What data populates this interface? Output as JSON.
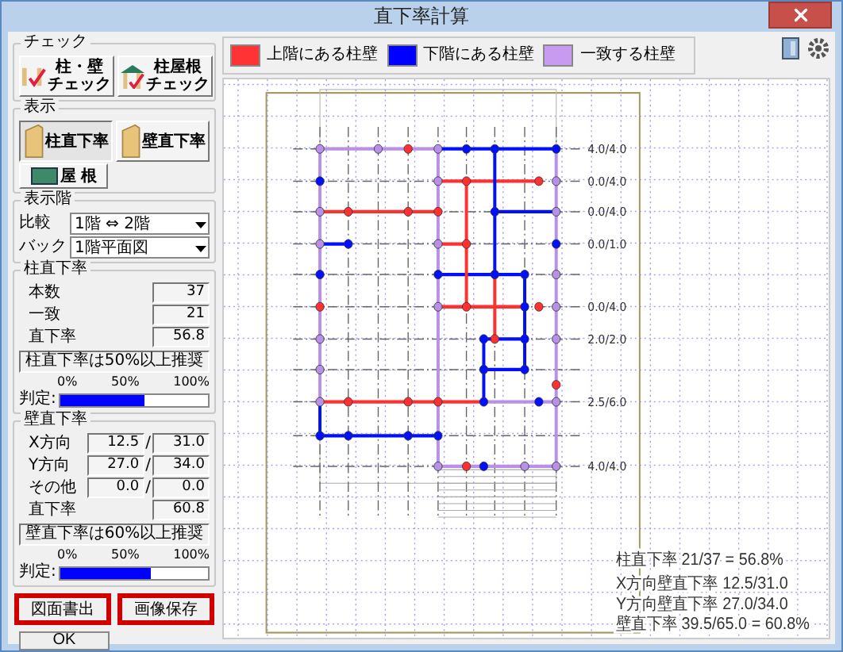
{
  "window": {
    "title": "直下率計算"
  },
  "check_group": {
    "title": "チェック",
    "buttons": [
      {
        "lines": [
          "柱・壁",
          "チェック"
        ]
      },
      {
        "lines": [
          "柱屋根",
          "チェック"
        ]
      }
    ]
  },
  "display_group": {
    "title": "表示",
    "buttons": [
      {
        "label": "柱直下率",
        "kind": "column",
        "selected": true
      },
      {
        "label": "壁直下率",
        "kind": "wall",
        "selected": false
      },
      {
        "label": "屋 根",
        "kind": "roof",
        "selected": false
      }
    ]
  },
  "floor_group": {
    "title": "表示階",
    "fields": [
      {
        "label": "比較",
        "value": "1階 ⇔ 2階"
      },
      {
        "label": "バック",
        "value": "1階平面図"
      }
    ]
  },
  "column_rate": {
    "title": "柱直下率",
    "rows": [
      {
        "label": "本数",
        "value": "37"
      },
      {
        "label": "一致",
        "value": "21"
      },
      {
        "label": "直下率",
        "value": "56.8"
      }
    ],
    "note": "柱直下率は50%以上推奨",
    "scale": [
      "0%",
      "50%",
      "100%"
    ],
    "judge_label": "判定:",
    "level": 0.568
  },
  "wall_rate": {
    "title": "壁直下率",
    "separator": "/",
    "rows": [
      {
        "label": "X方向",
        "value": "12.5",
        "total": "31.0"
      },
      {
        "label": "Y方向",
        "value": "27.0",
        "total": "34.0"
      },
      {
        "label": "その他",
        "value": "0.0",
        "total": "0.0"
      },
      {
        "label": "直下率",
        "value": "60.8"
      }
    ],
    "note": "壁直下率は60%以上推奨",
    "scale": [
      "0%",
      "50%",
      "100%"
    ],
    "judge_label": "判定:",
    "level": 0.608
  },
  "actions": [
    {
      "label": "図面書出",
      "highlighted": true
    },
    {
      "label": "画像保存",
      "highlighted": true
    }
  ],
  "ok_button": "OK",
  "legend": [
    {
      "label": "上階にある柱壁",
      "color": "#ff3333"
    },
    {
      "label": "下階にある柱壁",
      "color": "#0000ff"
    },
    {
      "label": "一致する柱壁",
      "color": "#c89af0"
    }
  ],
  "plan": {
    "right_labels": [
      "4.0/4.0",
      "0.0/4.0",
      "0.0/4.0",
      "0.0/1.0",
      "0.0/4.0",
      "2.0/2.0",
      "2.5/6.0",
      "4.0/4.0"
    ],
    "summary": [
      "柱直下率 21/37 = 56.8%",
      "X方向壁直下率 12.5/31.0",
      "Y方向壁直下率 27.0/34.0",
      "壁直下率 39.5/65.0 = 60.8%"
    ]
  }
}
